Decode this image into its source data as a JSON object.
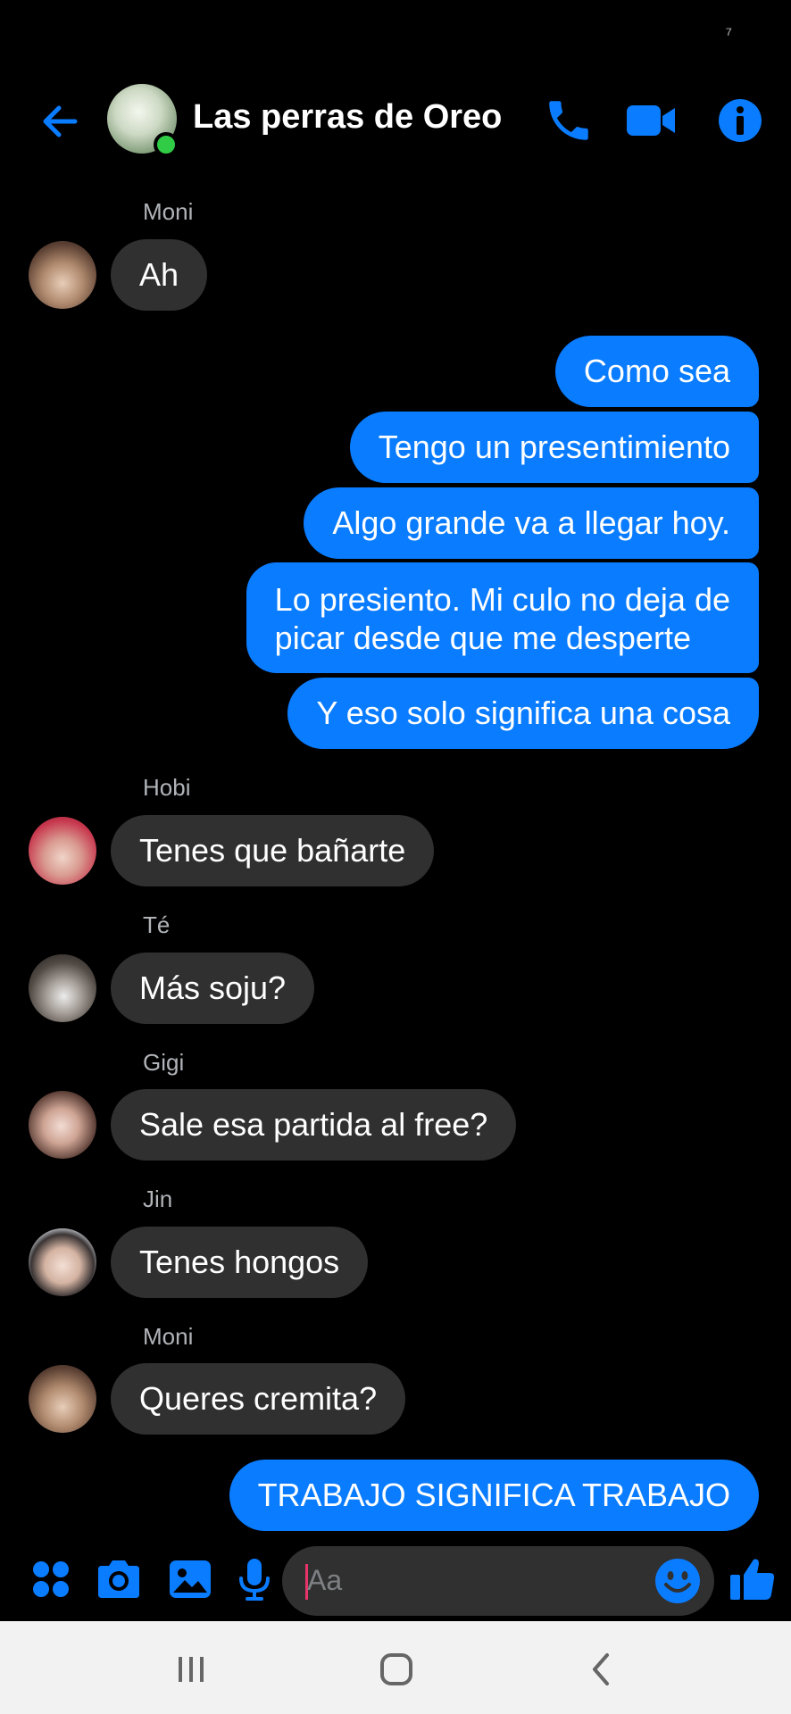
{
  "status": {
    "glyph": "⁷"
  },
  "header": {
    "title": "Las perras de Oreo",
    "icons": [
      "back-arrow-icon",
      "phone-icon",
      "video-camera-icon",
      "info-icon"
    ],
    "accent": "#0a7cff",
    "online_color": "#31cc46"
  },
  "messages": {
    "moni_name_1": "Moni",
    "moni_msg_1": "Ah",
    "out_1": "Como sea",
    "out_2": "Tengo un presentimiento",
    "out_3": "Algo grande va a llegar hoy.",
    "out_4_line1": "Lo presiento. Mi culo no deja de",
    "out_4_line2": "picar desde que me desperte",
    "out_5": "Y eso solo significa una cosa",
    "hobi_name": "Hobi",
    "hobi_msg": "Tenes que bañarte",
    "te_name": "Té",
    "te_msg": "Más soju?",
    "gigi_name": "Gigi",
    "gigi_msg": "Sale esa partida al free?",
    "jin_name": "Jin",
    "jin_msg": "Tenes hongos",
    "moni_name_2": "Moni",
    "moni_msg_2": "Queres cremita?",
    "out_6": "TRABAJO SIGNIFICA TRABAJO"
  },
  "composer": {
    "placeholder": "Aa",
    "icons": [
      "apps-grid-icon",
      "camera-icon",
      "gallery-icon",
      "microphone-icon",
      "emoji-icon",
      "thumbs-up-icon"
    ]
  },
  "nav": {
    "icons": [
      "recent-apps-icon",
      "home-icon",
      "back-icon"
    ]
  }
}
